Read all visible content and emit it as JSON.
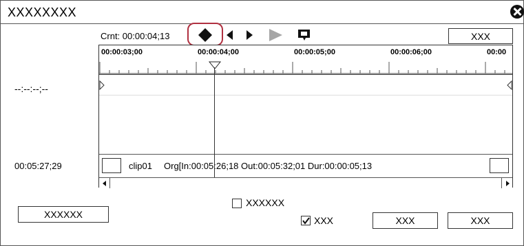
{
  "window": {
    "title": "XXXXXXXX"
  },
  "toolbar": {
    "current_time": "Crnt: 00:00:04;13",
    "top_right_button": "XXX"
  },
  "ruler": {
    "labels": [
      "00:00:03;00",
      "00:00:04;00",
      "00:00:05;00",
      "00:00:06;00",
      "00:00"
    ]
  },
  "left_panel": {
    "time_top": "--:--:--;--",
    "time_bottom": "00:05:27;29"
  },
  "clip": {
    "name": "clip01",
    "info": "Org[In:00:05:26;18 Out:00:05:32;01 Dur:00:00:05;13"
  },
  "bottom": {
    "left_button": "XXXXXX",
    "checkbox1_label": "XXXXXX",
    "checkbox1_checked": false,
    "checkbox2_label": "XXX",
    "checkbox2_checked": true,
    "ok_button": "XXX",
    "cancel_button": "XXX"
  }
}
